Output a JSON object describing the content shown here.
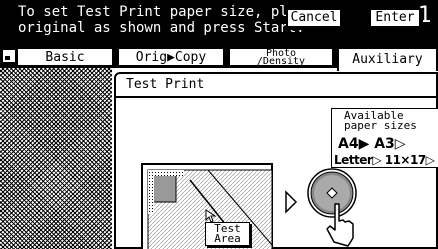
{
  "banner": {
    "line1": "To set Test Print paper size, place",
    "line2": "original as shown and press Start.",
    "step_number": "1"
  },
  "tabs": {
    "basic": "Basic",
    "orig_copy": "Orig▶Copy",
    "photo_density_a": "Photo",
    "photo_density_b": "/Density",
    "auxiliary": "Auxiliary"
  },
  "dialog": {
    "title": "Test Print",
    "cancel_label": "Cancel",
    "enter_label": "Enter"
  },
  "paper_sizes": {
    "header_line1": "Available",
    "header_line2": "paper sizes",
    "row1": "A4▶ A3▷",
    "row2": "Letter▷ 11×17▷"
  },
  "illustration": {
    "test_area_line1": "Test",
    "test_area_line2": "Area",
    "start_icon": "start-button-icon",
    "hand_icon": "pointing-hand-icon"
  }
}
